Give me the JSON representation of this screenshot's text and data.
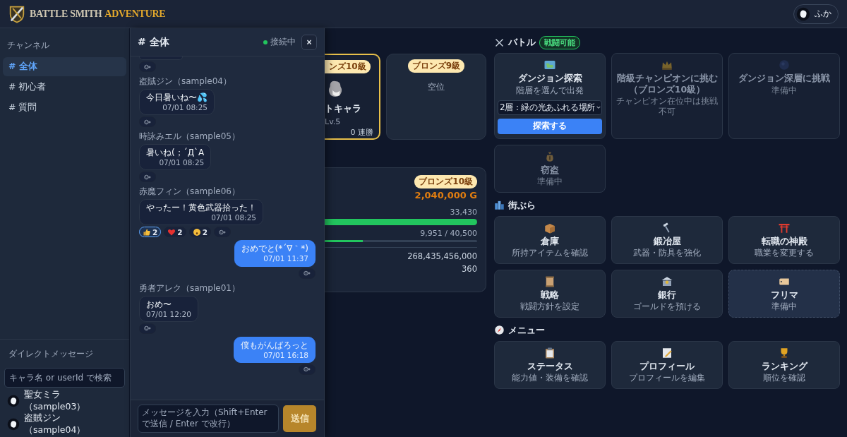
{
  "header": {
    "logo": {
      "primary": "BATTLE SMITH",
      "accent": "ADVENTURE"
    },
    "user": {
      "name": "ふか"
    }
  },
  "sidebar": {
    "channels_label": "チャンネル",
    "channels": [
      {
        "label": "# 全体",
        "selected": true
      },
      {
        "label": "# 初心者",
        "selected": false
      },
      {
        "label": "# 質問",
        "selected": false
      }
    ],
    "dm_label": "ダイレクトメッセージ",
    "dm_search": {
      "placeholder": "キャラ名 or userId で検索"
    },
    "dm_users": [
      {
        "name": "聖女ミラ（sample03）"
      },
      {
        "name": "盗賊ジン（sample04）"
      }
    ]
  },
  "chat": {
    "title": "# 全体",
    "status": "接続中",
    "connected": true,
    "close": "×",
    "messages": [
      {
        "kind": "partial"
      },
      {
        "kind": "other",
        "author": "盗賊ジン（sample04）",
        "text": "今日暑いね〜💦",
        "time": "07/01 08:25"
      },
      {
        "kind": "other",
        "author": "時詠みエル（sample05）",
        "text": "暑いね(；´Д`A",
        "time": "07/01 08:25"
      },
      {
        "kind": "other",
        "author": "赤魔フィン（sample06）",
        "text": "やったー！黄色武器拾った！",
        "time": "07/01 08:25",
        "reactions": [
          {
            "count": "2",
            "selected": true
          },
          {
            "count": "2",
            "selected": false
          },
          {
            "count": "2",
            "selected": false
          }
        ]
      },
      {
        "kind": "mine",
        "text": "おめでと(*´∇｀*)",
        "time": "07/01 11:37"
      },
      {
        "kind": "other",
        "author": "勇者アレク（sample01）",
        "text": "おめ〜",
        "time": "07/01 12:20"
      },
      {
        "kind": "mine",
        "text": "僕もがんばろっと",
        "time": "07/01 16:18"
      }
    ],
    "input": {
      "placeholder": "メッセージを入力（Shift+Enter で送信 / Enter で改行）"
    },
    "send": "送信"
  },
  "champions": [
    {
      "kind": "holder",
      "rank": "ンズ10級",
      "name": "トキャラ",
      "level": "Lv.5",
      "streak": "0 連勝",
      "mine": true
    },
    {
      "kind": "vacant",
      "rank": "ブロンズ9級",
      "status": "空位",
      "mine": false
    }
  ],
  "profile_panel": {
    "rank": "ブロンズ10級",
    "gold": "2,040,000 G",
    "bars": [
      {
        "reading": "33,430",
        "level": 1.0
      },
      {
        "reading": "9,951 / 40,500",
        "level": 0.25
      }
    ],
    "stats": [
      "268,435,456,000",
      "360"
    ]
  },
  "battle": {
    "title": "バトル",
    "badge": "戦闘可能",
    "cards": [
      {
        "kind": "explore",
        "title": "ダンジョン探索",
        "subtitle": "階層を選んで出発",
        "select": "2層：緑の光あふれる場所",
        "button": "探索する"
      },
      {
        "kind": "locked",
        "title": "階級チャンピオンに挑む（ブロンズ10級）",
        "subtitle": "チャンピオン在位中は挑戦不可"
      },
      {
        "kind": "locked",
        "title": "ダンジョン深層に挑戦",
        "subtitle": "準備中"
      },
      {
        "kind": "locked",
        "title": "窃盗",
        "subtitle": "準備中"
      }
    ]
  },
  "town": {
    "title": "街ぶら",
    "cards": [
      {
        "kind": "link",
        "title": "倉庫",
        "subtitle": "所持アイテムを確認"
      },
      {
        "kind": "link",
        "title": "鍛冶屋",
        "subtitle": "武器・防具を強化"
      },
      {
        "kind": "link",
        "title": "転職の神殿",
        "subtitle": "職業を変更する"
      },
      {
        "kind": "link",
        "title": "戦略",
        "subtitle": "戦闘方針を設定"
      },
      {
        "kind": "link",
        "title": "銀行",
        "subtitle": "ゴールドを預ける"
      },
      {
        "kind": "soon",
        "title": "フリマ",
        "subtitle": "準備中"
      }
    ]
  },
  "menu": {
    "title": "メニュー",
    "cards": [
      {
        "kind": "link",
        "title": "ステータス",
        "subtitle": "能力値・装備を確認"
      },
      {
        "kind": "link",
        "title": "プロフィール",
        "subtitle": "プロフィールを編集"
      },
      {
        "kind": "link",
        "title": "ランキング",
        "subtitle": "順位を確認"
      }
    ]
  }
}
